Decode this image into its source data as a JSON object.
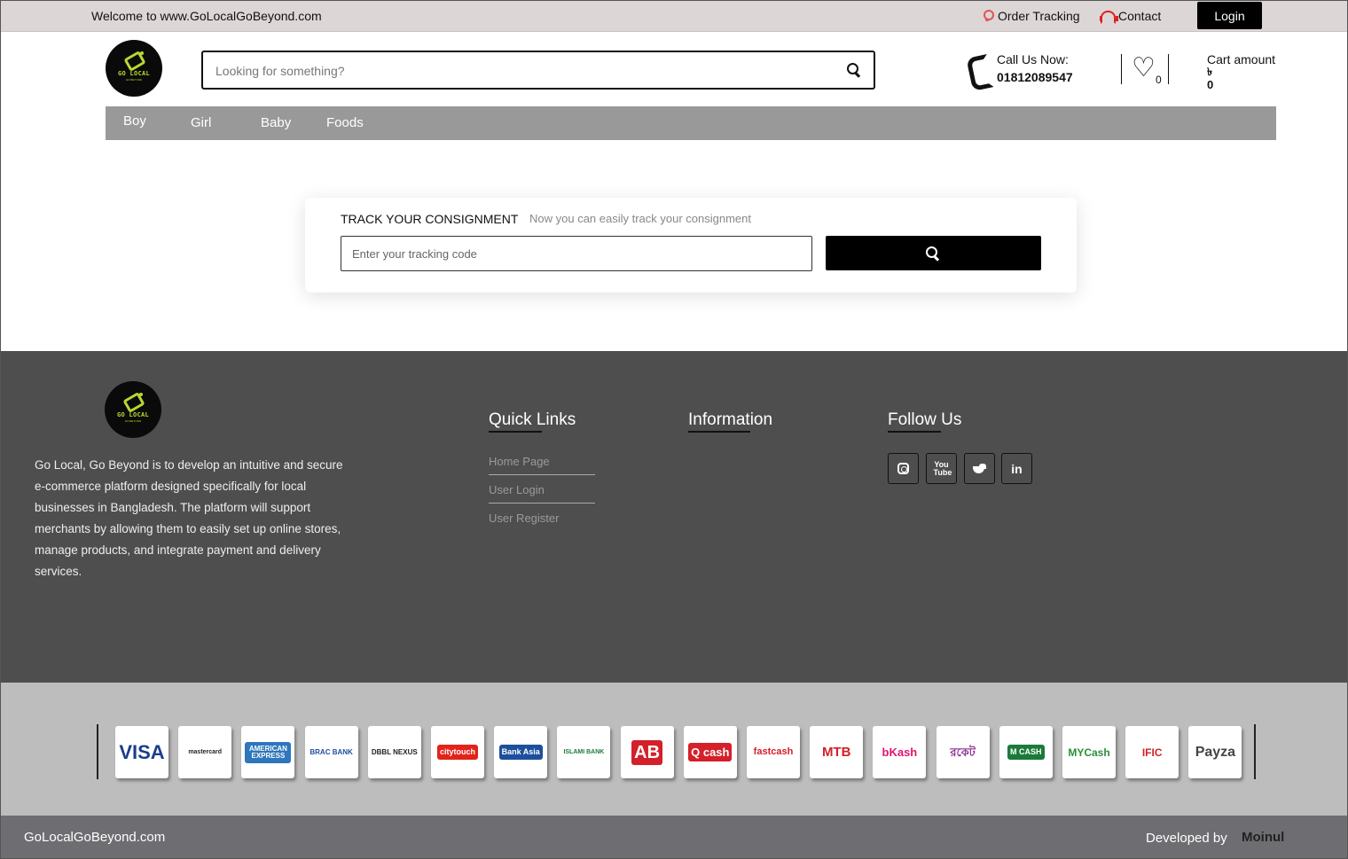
{
  "topbar": {
    "welcome": "Welcome to www.GoLocalGoBeyond.com",
    "order_tracking": "Order Tracking",
    "contact": "Contact",
    "login": "Login"
  },
  "logo": {
    "text": "GO LOCAL",
    "sub": "GO BEYOND"
  },
  "header": {
    "search_placeholder": "Looking for something?",
    "call_label": "Call Us Now:",
    "call_number": "01812089547",
    "wishlist_count": "0",
    "cart_label": "Cart amount",
    "cart_currency": "৳",
    "cart_value": "0"
  },
  "nav": {
    "items": [
      "Boy",
      "Girl",
      "Baby",
      "Foods"
    ]
  },
  "track": {
    "title": "TRACK YOUR CONSIGNMENT",
    "subtitle": "Now you can easily track your consignment",
    "placeholder": "Enter your tracking code"
  },
  "footer": {
    "about": "Go Local, Go Beyond is to develop an intuitive and secure e-commerce platform designed specifically for local businesses in Bangladesh. The platform will support merchants by allowing them to easily set up online stores, manage products, and integrate payment and delivery services.",
    "quick_links_title": "Quick Links",
    "quick_links": [
      "Home Page",
      "User Login",
      "User Register"
    ],
    "information_title": "Information",
    "follow_title": "Follow Us",
    "social": [
      "instagram-icon",
      "youtube-icon",
      "twitter-icon",
      "linkedin-icon"
    ],
    "social_linkedin": "in",
    "social_youtube": "You Tube"
  },
  "payments": [
    {
      "name": "VISA",
      "color": "#1a3e8c"
    },
    {
      "name": "mastercard",
      "color": "#222222"
    },
    {
      "name": "AMERICAN EXPRESS",
      "color": "#ffffff"
    },
    {
      "name": "BRAC BANK",
      "color": "#1f4ea3"
    },
    {
      "name": "DBBL NEXUS",
      "color": "#222222"
    },
    {
      "name": "citytouch",
      "color": "#ffffff"
    },
    {
      "name": "Bank Asia",
      "color": "#ffffff"
    },
    {
      "name": "ISLAMI BANK",
      "color": "#1b7a3a"
    },
    {
      "name": "AB",
      "color": "#ffffff"
    },
    {
      "name": "Q cash",
      "color": "#ffffff"
    },
    {
      "name": "fastcash",
      "color": "#d4202a"
    },
    {
      "name": "MTB",
      "color": "#d4202a"
    },
    {
      "name": "bKash",
      "color": "#e2136e"
    },
    {
      "name": "রকেট",
      "color": "#8c3494"
    },
    {
      "name": "M CASH",
      "color": "#ffffff"
    },
    {
      "name": "MYCash",
      "color": "#2a8f3a"
    },
    {
      "name": "IFIC",
      "color": "#d4202a"
    },
    {
      "name": "Payza",
      "color": "#444444"
    }
  ],
  "bottom": {
    "copyright": "GoLocalGoBeyond.com",
    "developed_by": "Developed by",
    "developer": "Moinul"
  }
}
